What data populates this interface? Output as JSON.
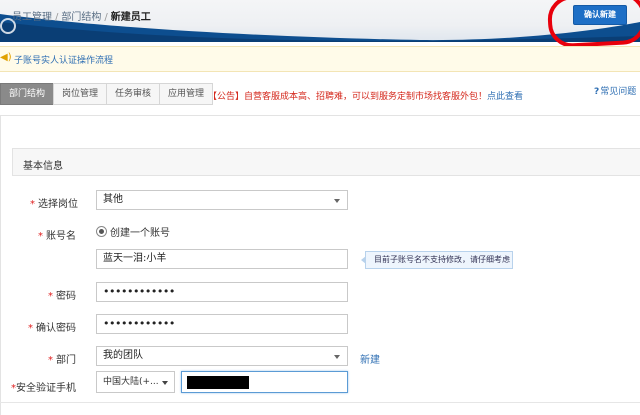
{
  "header": {
    "breadcrumb": [
      "员工管理",
      "部门结构",
      "新建员工"
    ],
    "separator": "/",
    "confirm_label": "确认新建"
  },
  "notice": {
    "text": "子账号实人认证操作流程"
  },
  "tabs": [
    {
      "label": "部门结构",
      "active": true
    },
    {
      "label": "岗位管理",
      "active": false
    },
    {
      "label": "任务审核",
      "active": false
    },
    {
      "label": "应用管理",
      "active": false
    }
  ],
  "announcement": {
    "text": "【公告】自营客服成本高、招聘难，可以到服务定制市场找客服外包！",
    "link": "点此查看"
  },
  "help": {
    "label": "常见问题"
  },
  "section": {
    "title": "基本信息"
  },
  "form": {
    "position": {
      "label": "选择岗位",
      "value": "其他"
    },
    "account": {
      "label": "账号名",
      "radio_label": "创建一个账号",
      "value": "蓝天一泪:小羊",
      "tip": "目前子账号名不支持修改，请仔细考虑"
    },
    "password": {
      "label": "密码",
      "value": "••••••••••••"
    },
    "confirm_password": {
      "label": "确认密码",
      "value": "••••••••••••"
    },
    "department": {
      "label": "部门",
      "value": "我的团队",
      "new_link": "新建"
    },
    "phone": {
      "label": "安全验证手机",
      "country": "中国大陆(+..."
    }
  },
  "colors": {
    "primary": "#1e6fc6",
    "required": "#e02020",
    "link": "#2f6fb3",
    "annotation": "#e8000c"
  }
}
